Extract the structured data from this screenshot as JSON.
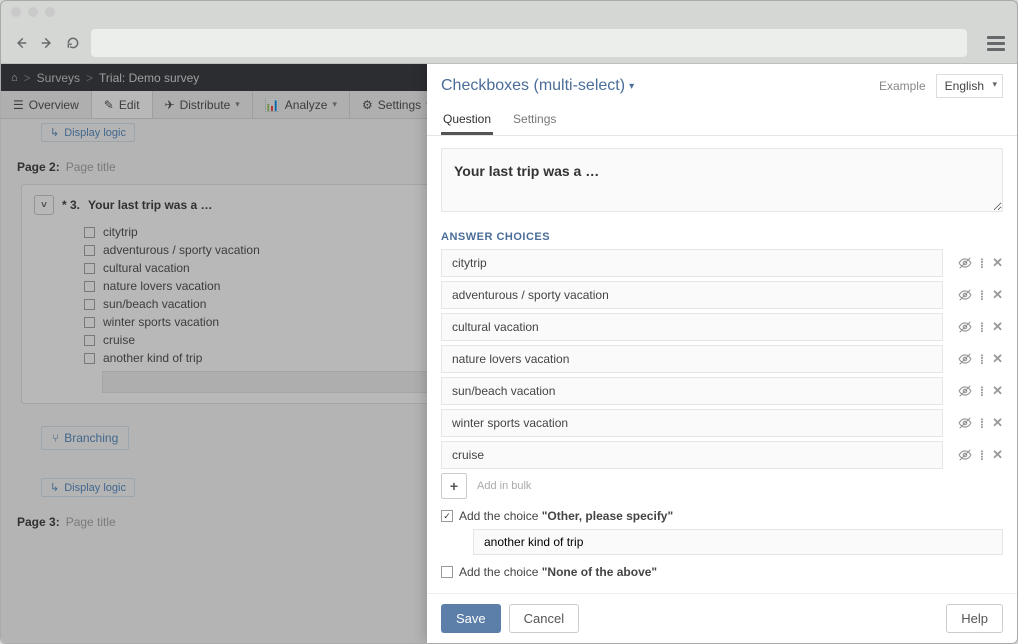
{
  "breadcrumb": {
    "surveys": "Surveys",
    "trial": "Trial: Demo survey"
  },
  "tabs": {
    "overview": "Overview",
    "edit": "Edit",
    "distribute": "Distribute",
    "analyze": "Analyze",
    "settings": "Settings"
  },
  "links": {
    "display_logic": "Display logic",
    "branching": "Branching"
  },
  "pages": {
    "page2_label": "Page 2:",
    "page3_label": "Page 3:",
    "title_placeholder": "Page title"
  },
  "question_bg": {
    "number": "* 3.",
    "title": "Your last trip was a …",
    "options": [
      "citytrip",
      "adventurous / sporty vacation",
      "cultural vacation",
      "nature lovers vacation",
      "sun/beach vacation",
      "winter sports vacation",
      "cruise",
      "another kind of trip"
    ]
  },
  "panel": {
    "title": "Checkboxes (multi-select)",
    "example": "Example",
    "language": "English",
    "tab_question": "Question",
    "tab_settings": "Settings",
    "question_text": "Your last trip was a …",
    "answer_choices_label": "ANSWER CHOICES",
    "choices": [
      "citytrip",
      "adventurous / sporty vacation",
      "cultural vacation",
      "nature lovers vacation",
      "sun/beach vacation",
      "winter sports vacation",
      "cruise"
    ],
    "add_in_bulk": "Add in bulk",
    "other_prefix": "Add the choice ",
    "other_bold": "\"Other, please specify\"",
    "other_value": "another kind of trip",
    "none_prefix": "Add the choice ",
    "none_bold": "\"None of the above\"",
    "save": "Save",
    "cancel": "Cancel",
    "help": "Help"
  }
}
